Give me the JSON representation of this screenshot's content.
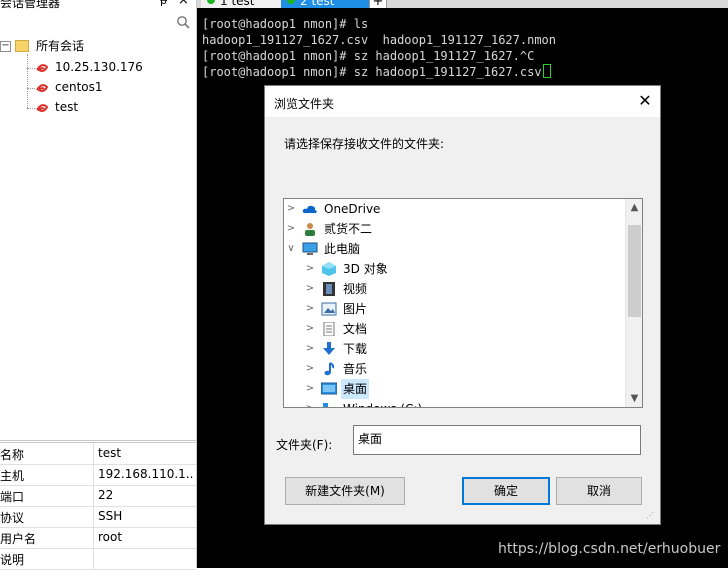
{
  "session_panel": {
    "title": "会话管理器",
    "pin_glyph": "ᵽ",
    "close_glyph": "×",
    "search_icon": "search-icon",
    "root_label": "所有会话",
    "sessions": [
      "10.25.130.176",
      "centos1",
      "test"
    ]
  },
  "properties": [
    {
      "key": "名称",
      "value": "test"
    },
    {
      "key": "主机",
      "value": "192.168.110.1..."
    },
    {
      "key": "端口",
      "value": "22"
    },
    {
      "key": "协议",
      "value": "SSH"
    },
    {
      "key": "用户名",
      "value": "root"
    },
    {
      "key": "说明",
      "value": ""
    }
  ],
  "tabs": [
    {
      "label": "1 test",
      "active": false
    },
    {
      "label": "2 test",
      "active": true
    }
  ],
  "tab_add": "+",
  "terminal_lines": [
    "[root@hadoop1 nmon]# ls",
    "hadoop1_191127_1627.csv  hadoop1_191127_1627.nmon",
    "[root@hadoop1 nmon]# sz hadoop1_191127_1627.^C",
    "[root@hadoop1 nmon]# sz hadoop1_191127_1627.csv"
  ],
  "dialog": {
    "title": "浏览文件夹",
    "close_glyph": "✕",
    "description": "请选择保存接收文件的文件夹:",
    "tree": [
      {
        "label": "OneDrive",
        "icon": "cloud-icon",
        "level": 0,
        "expanded": false
      },
      {
        "label": "贰货不二",
        "icon": "user-folder-icon",
        "level": 0,
        "expanded": false
      },
      {
        "label": "此电脑",
        "icon": "computer-icon",
        "level": 0,
        "expanded": true
      },
      {
        "label": "3D 对象",
        "icon": "cube-icon",
        "level": 1,
        "expanded": false
      },
      {
        "label": "视频",
        "icon": "video-icon",
        "level": 1,
        "expanded": false
      },
      {
        "label": "图片",
        "icon": "picture-icon",
        "level": 1,
        "expanded": false
      },
      {
        "label": "文档",
        "icon": "document-icon",
        "level": 1,
        "expanded": false
      },
      {
        "label": "下载",
        "icon": "download-icon",
        "level": 1,
        "expanded": false
      },
      {
        "label": "音乐",
        "icon": "music-icon",
        "level": 1,
        "expanded": false
      },
      {
        "label": "桌面",
        "icon": "desktop-icon",
        "level": 1,
        "expanded": false,
        "selected": true
      },
      {
        "label": "Windows (C:)",
        "icon": "drive-icon",
        "level": 1,
        "expanded": false
      }
    ],
    "folder_label": "文件夹(F):",
    "folder_value": "桌面",
    "new_folder_button": "新建文件夹(M)",
    "ok_button": "确定",
    "cancel_button": "取消"
  },
  "watermark": "https://blog.csdn.net/erhuobuer",
  "colors": {
    "terminal_bg": "#000000",
    "active_tab": "#1f8fe6",
    "selection": "#cce8ff",
    "ok_border": "#0078d7"
  }
}
